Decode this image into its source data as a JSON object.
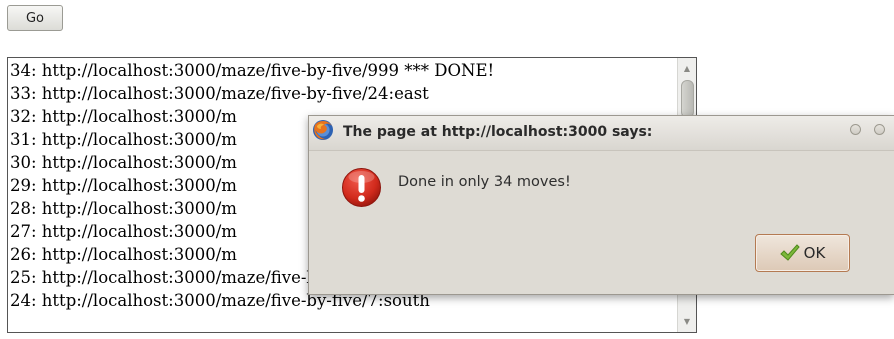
{
  "toolbar": {
    "go_label": "Go"
  },
  "log": {
    "lines": [
      "34: http://localhost:3000/maze/five-by-five/999 *** DONE!",
      "33: http://localhost:3000/maze/five-by-five/24:east",
      "32: http://localhost:3000/m",
      "31: http://localhost:3000/m",
      "30: http://localhost:3000/m",
      "29: http://localhost:3000/m",
      "28: http://localhost:3000/m",
      "27: http://localhost:3000/m",
      "26: http://localhost:3000/m",
      "25: http://localhost:3000/maze/five-by-five/2:west",
      "24: http://localhost:3000/maze/five-by-five/7:south"
    ]
  },
  "dialog": {
    "title": "The page at http://localhost:3000 says:",
    "message": "Done in only 34 moves!",
    "ok_label": "OK"
  },
  "icons": {
    "title_icon": "firefox-icon",
    "alert_icon": "exclamation-icon",
    "ok_icon": "check-icon"
  },
  "colors": {
    "alert_red": "#d12a1c",
    "check_green": "#7cb83a",
    "dialog_bg": "#dedbd4"
  }
}
